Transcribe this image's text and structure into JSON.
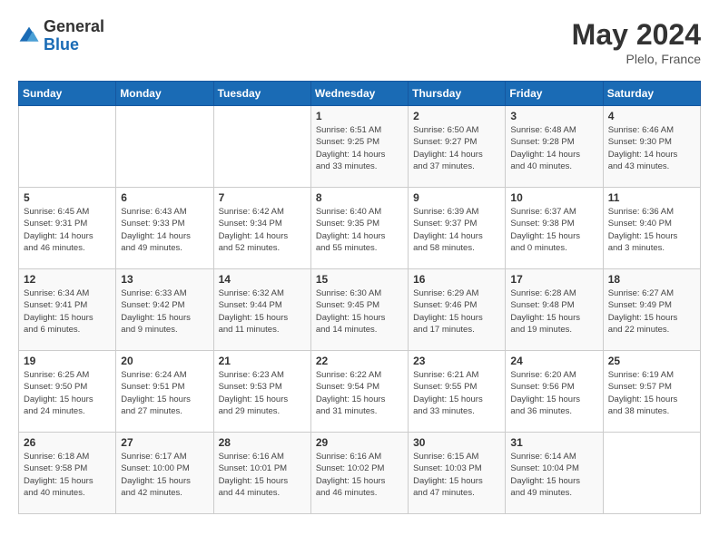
{
  "header": {
    "logo_general": "General",
    "logo_blue": "Blue",
    "month_year": "May 2024",
    "location": "Plelo, France"
  },
  "days_of_week": [
    "Sunday",
    "Monday",
    "Tuesday",
    "Wednesday",
    "Thursday",
    "Friday",
    "Saturday"
  ],
  "weeks": [
    [
      {
        "day": "",
        "info": ""
      },
      {
        "day": "",
        "info": ""
      },
      {
        "day": "",
        "info": ""
      },
      {
        "day": "1",
        "info": "Sunrise: 6:51 AM\nSunset: 9:25 PM\nDaylight: 14 hours\nand 33 minutes."
      },
      {
        "day": "2",
        "info": "Sunrise: 6:50 AM\nSunset: 9:27 PM\nDaylight: 14 hours\nand 37 minutes."
      },
      {
        "day": "3",
        "info": "Sunrise: 6:48 AM\nSunset: 9:28 PM\nDaylight: 14 hours\nand 40 minutes."
      },
      {
        "day": "4",
        "info": "Sunrise: 6:46 AM\nSunset: 9:30 PM\nDaylight: 14 hours\nand 43 minutes."
      }
    ],
    [
      {
        "day": "5",
        "info": "Sunrise: 6:45 AM\nSunset: 9:31 PM\nDaylight: 14 hours\nand 46 minutes."
      },
      {
        "day": "6",
        "info": "Sunrise: 6:43 AM\nSunset: 9:33 PM\nDaylight: 14 hours\nand 49 minutes."
      },
      {
        "day": "7",
        "info": "Sunrise: 6:42 AM\nSunset: 9:34 PM\nDaylight: 14 hours\nand 52 minutes."
      },
      {
        "day": "8",
        "info": "Sunrise: 6:40 AM\nSunset: 9:35 PM\nDaylight: 14 hours\nand 55 minutes."
      },
      {
        "day": "9",
        "info": "Sunrise: 6:39 AM\nSunset: 9:37 PM\nDaylight: 14 hours\nand 58 minutes."
      },
      {
        "day": "10",
        "info": "Sunrise: 6:37 AM\nSunset: 9:38 PM\nDaylight: 15 hours\nand 0 minutes."
      },
      {
        "day": "11",
        "info": "Sunrise: 6:36 AM\nSunset: 9:40 PM\nDaylight: 15 hours\nand 3 minutes."
      }
    ],
    [
      {
        "day": "12",
        "info": "Sunrise: 6:34 AM\nSunset: 9:41 PM\nDaylight: 15 hours\nand 6 minutes."
      },
      {
        "day": "13",
        "info": "Sunrise: 6:33 AM\nSunset: 9:42 PM\nDaylight: 15 hours\nand 9 minutes."
      },
      {
        "day": "14",
        "info": "Sunrise: 6:32 AM\nSunset: 9:44 PM\nDaylight: 15 hours\nand 11 minutes."
      },
      {
        "day": "15",
        "info": "Sunrise: 6:30 AM\nSunset: 9:45 PM\nDaylight: 15 hours\nand 14 minutes."
      },
      {
        "day": "16",
        "info": "Sunrise: 6:29 AM\nSunset: 9:46 PM\nDaylight: 15 hours\nand 17 minutes."
      },
      {
        "day": "17",
        "info": "Sunrise: 6:28 AM\nSunset: 9:48 PM\nDaylight: 15 hours\nand 19 minutes."
      },
      {
        "day": "18",
        "info": "Sunrise: 6:27 AM\nSunset: 9:49 PM\nDaylight: 15 hours\nand 22 minutes."
      }
    ],
    [
      {
        "day": "19",
        "info": "Sunrise: 6:25 AM\nSunset: 9:50 PM\nDaylight: 15 hours\nand 24 minutes."
      },
      {
        "day": "20",
        "info": "Sunrise: 6:24 AM\nSunset: 9:51 PM\nDaylight: 15 hours\nand 27 minutes."
      },
      {
        "day": "21",
        "info": "Sunrise: 6:23 AM\nSunset: 9:53 PM\nDaylight: 15 hours\nand 29 minutes."
      },
      {
        "day": "22",
        "info": "Sunrise: 6:22 AM\nSunset: 9:54 PM\nDaylight: 15 hours\nand 31 minutes."
      },
      {
        "day": "23",
        "info": "Sunrise: 6:21 AM\nSunset: 9:55 PM\nDaylight: 15 hours\nand 33 minutes."
      },
      {
        "day": "24",
        "info": "Sunrise: 6:20 AM\nSunset: 9:56 PM\nDaylight: 15 hours\nand 36 minutes."
      },
      {
        "day": "25",
        "info": "Sunrise: 6:19 AM\nSunset: 9:57 PM\nDaylight: 15 hours\nand 38 minutes."
      }
    ],
    [
      {
        "day": "26",
        "info": "Sunrise: 6:18 AM\nSunset: 9:58 PM\nDaylight: 15 hours\nand 40 minutes."
      },
      {
        "day": "27",
        "info": "Sunrise: 6:17 AM\nSunset: 10:00 PM\nDaylight: 15 hours\nand 42 minutes."
      },
      {
        "day": "28",
        "info": "Sunrise: 6:16 AM\nSunset: 10:01 PM\nDaylight: 15 hours\nand 44 minutes."
      },
      {
        "day": "29",
        "info": "Sunrise: 6:16 AM\nSunset: 10:02 PM\nDaylight: 15 hours\nand 46 minutes."
      },
      {
        "day": "30",
        "info": "Sunrise: 6:15 AM\nSunset: 10:03 PM\nDaylight: 15 hours\nand 47 minutes."
      },
      {
        "day": "31",
        "info": "Sunrise: 6:14 AM\nSunset: 10:04 PM\nDaylight: 15 hours\nand 49 minutes."
      },
      {
        "day": "",
        "info": ""
      }
    ]
  ]
}
